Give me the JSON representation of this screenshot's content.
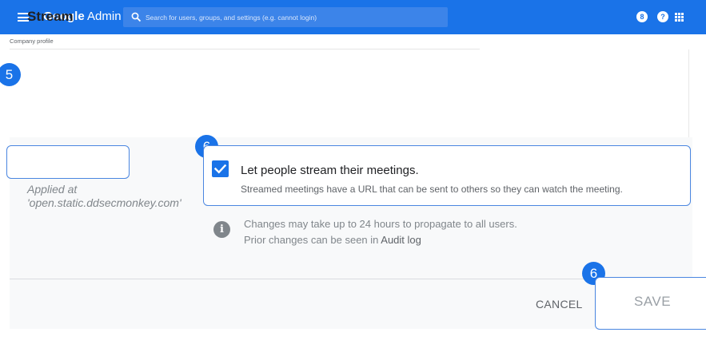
{
  "header": {
    "logo_google": "Google",
    "logo_admin": "Admin",
    "search_placeholder": "Search for users, groups, and settings (e.g. cannot login)",
    "badge_count": "8",
    "help_glyph": "?"
  },
  "breadcrumb": "Company profile",
  "steps": {
    "first": "5",
    "second": "6",
    "third": "6"
  },
  "setting": {
    "title": "Stream",
    "applied_line1": "Applied at",
    "applied_line2": "'open.static.ddsecmonkey.com'",
    "option_checked": true,
    "option_label": "Let people stream their meetings.",
    "option_description": "Streamed meetings have a URL that can be sent to others so they can watch the meeting."
  },
  "info": {
    "line1": "Changes may take up to 24 hours to propagate to all users.",
    "line2_prefix": "Prior changes can be seen in ",
    "line2_link": "Audit log"
  },
  "buttons": {
    "cancel": "CANCEL",
    "save": "SAVE"
  },
  "icons": {
    "menu": "menu-icon",
    "search": "search-icon",
    "notifications": "notification-badge-icon",
    "help": "help-icon",
    "apps": "apps-grid-icon",
    "checkbox": "checkbox-checked-icon",
    "info": "info-icon"
  },
  "colors": {
    "brand": "#1a73e8",
    "highlight": "#4a86e0",
    "panel": "#f8f9fa"
  }
}
